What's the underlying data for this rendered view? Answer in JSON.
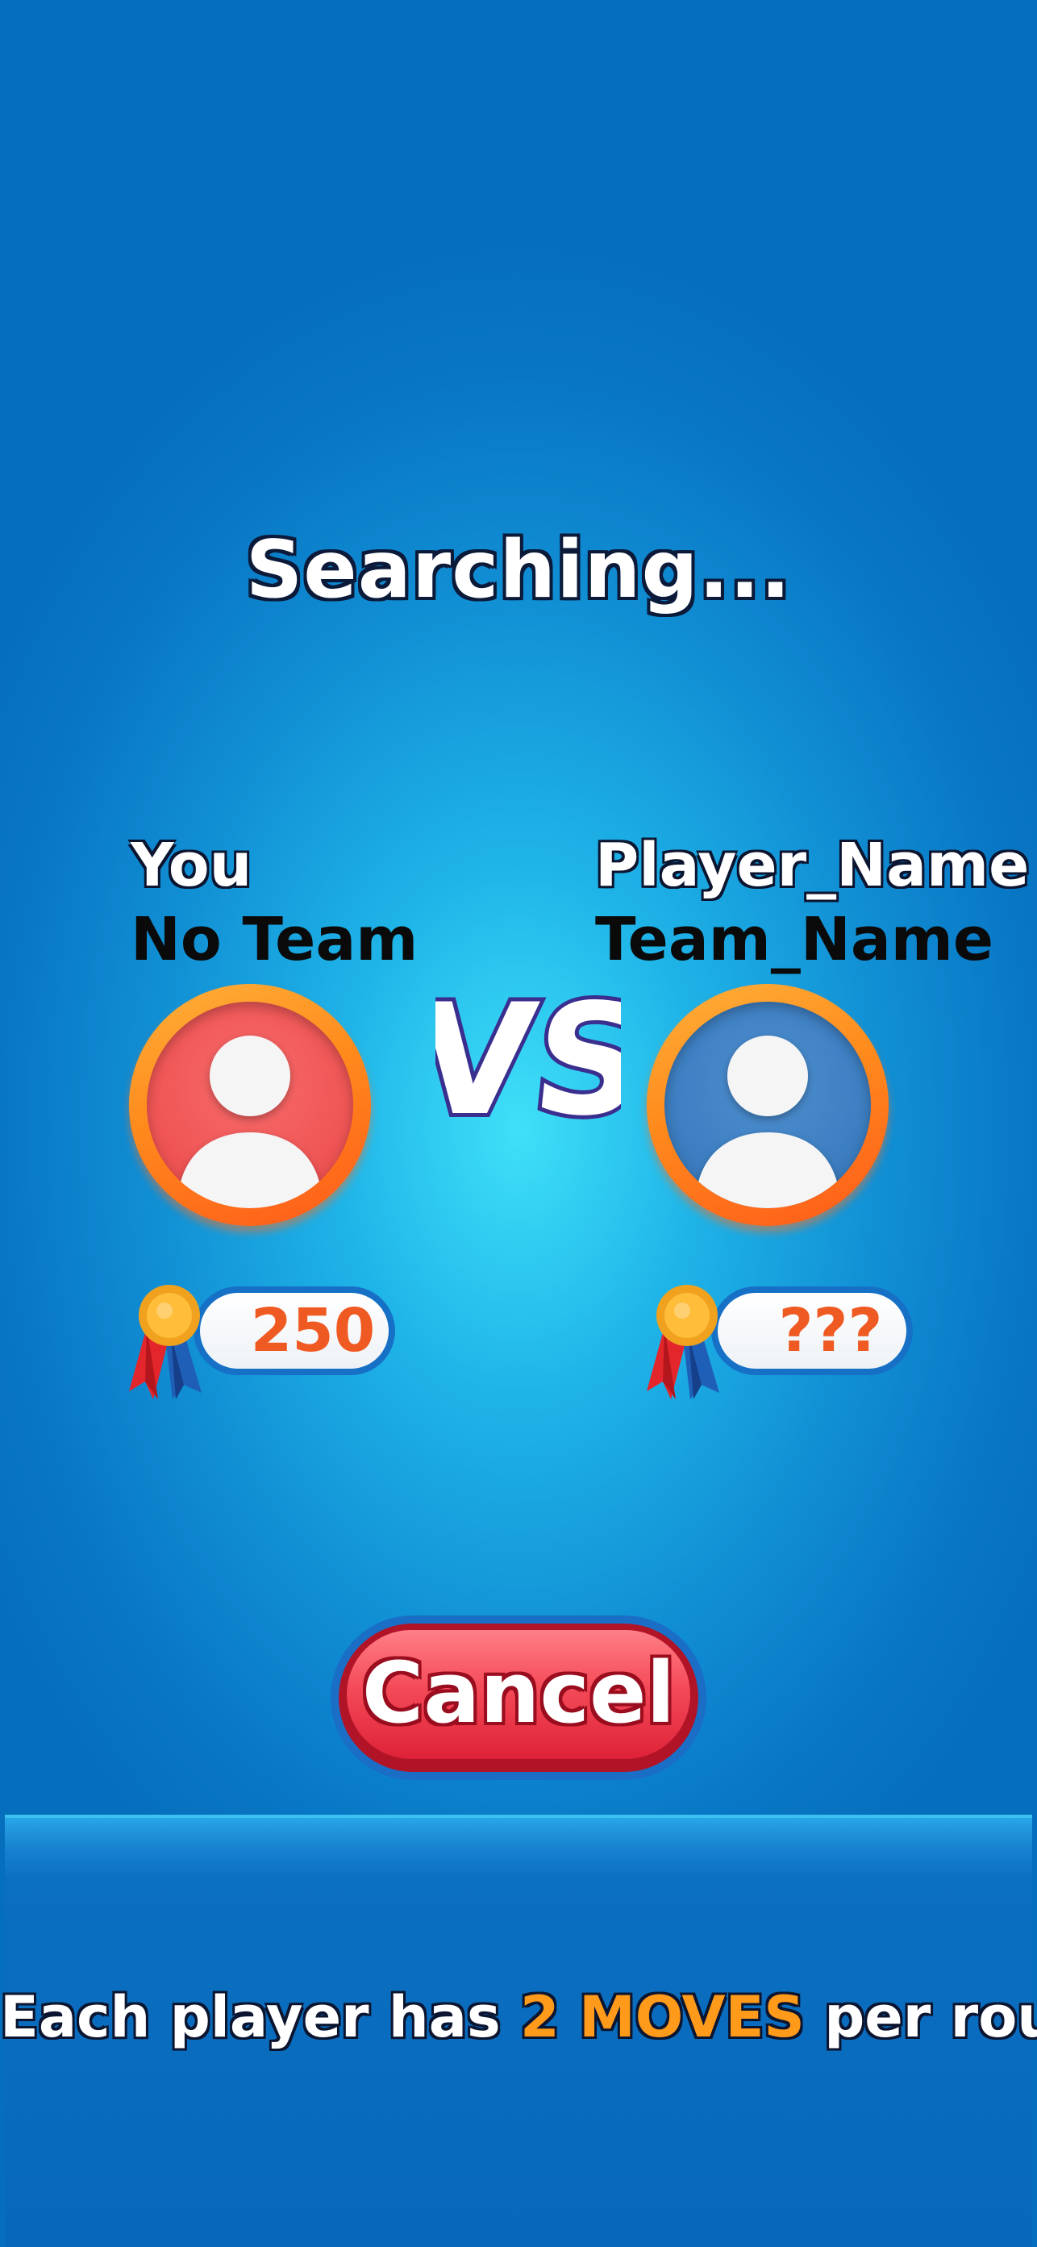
{
  "status": {
    "title": "Searching..."
  },
  "player": {
    "name": "You",
    "team": "No Team",
    "score": "250",
    "avatar_color": "#f05656"
  },
  "versus": {
    "label": "VS"
  },
  "opponent": {
    "name": "Player_Name",
    "team": "Team_Name",
    "score": "???",
    "avatar_color": "#3d7fc2"
  },
  "actions": {
    "cancel_label": "Cancel"
  },
  "tip": {
    "prefix": "Each player has ",
    "highlight": "2 MOVES",
    "suffix": " per round",
    "highlight_color": "#ff9a1a"
  },
  "icons": {
    "avatar": "user-silhouette-icon",
    "rank": "medal-ribbon-icon"
  }
}
